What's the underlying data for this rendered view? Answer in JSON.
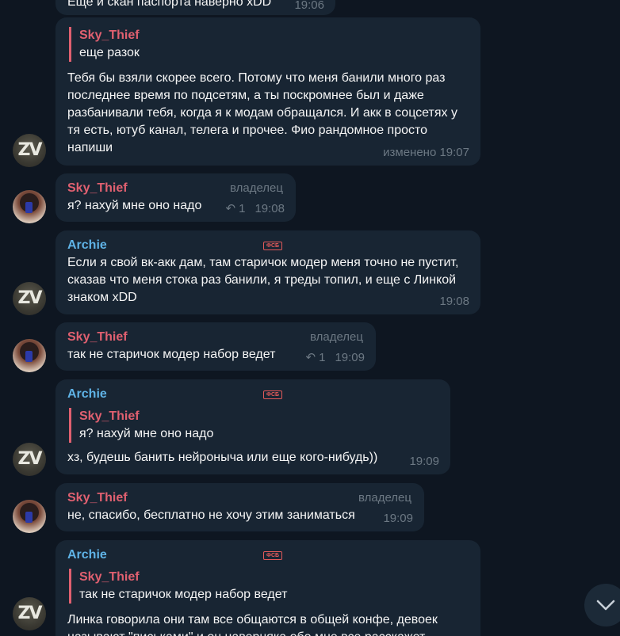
{
  "messages": [
    {
      "id": "m0",
      "text": "Еще и скан паспорта наверно xDD",
      "time": "19:06"
    },
    {
      "id": "m1",
      "reply": {
        "author": "Sky_Thief",
        "text": "еще разок"
      },
      "text": "Тебя бы взяли скорее всего. Потому что меня банили много раз последнее время по подсетям, а ты поскромнее был и даже разбанивали тебя, когда я к модам обращался. И акк в соцсетях у тя есть, ютуб канал, телега и прочее. Фио рандомное просто напиши",
      "time": "изменено 19:07"
    },
    {
      "id": "m2",
      "author": "Sky_Thief",
      "role": "владелец",
      "text": "я? нахуй мне оно надо",
      "replies": "1",
      "time": "19:08"
    },
    {
      "id": "m3",
      "author": "Archie",
      "badge": "ФСБ",
      "text": "Если я свой вк-акк дам, там старичок модер меня точно не пустит, сказав что меня стока раз банили, я треды топил, и еще с Линкой знаком xDD",
      "time": "19:08"
    },
    {
      "id": "m4",
      "author": "Sky_Thief",
      "role": "владелец",
      "text": "так не старичок модер набор ведет",
      "replies": "1",
      "time": "19:09"
    },
    {
      "id": "m5",
      "author": "Archie",
      "badge": "ФСБ",
      "reply": {
        "author": "Sky_Thief",
        "text": "я? нахуй мне оно надо"
      },
      "text": "хз, будешь банить нейроныча или еще кого-нибудь))",
      "time": "19:09"
    },
    {
      "id": "m6",
      "author": "Sky_Thief",
      "role": "владелец",
      "text": "не, спасибо, бесплатно не хочу этим заниматься",
      "time": "19:09"
    },
    {
      "id": "m7",
      "author": "Archie",
      "badge": "ФСБ",
      "reply": {
        "author": "Sky_Thief",
        "text": "так не старичок модер набор ведет"
      },
      "text": "Линка говорила они там все общаются в общей конфе, девоек называют \"письками\" и он наверняка обо мне все расскажет"
    }
  ],
  "avatars": {
    "archie": "ZV",
    "sky": "sky-thief-avatar"
  },
  "icons": {
    "reply": "reply-arrow-icon",
    "scroll": "chevron-down-icon"
  },
  "colors": {
    "background": "#0e1621",
    "bubble": "#182533",
    "sky_name": "#e06070",
    "archie_name": "#5fb3e6",
    "meta": "#6c7883"
  }
}
